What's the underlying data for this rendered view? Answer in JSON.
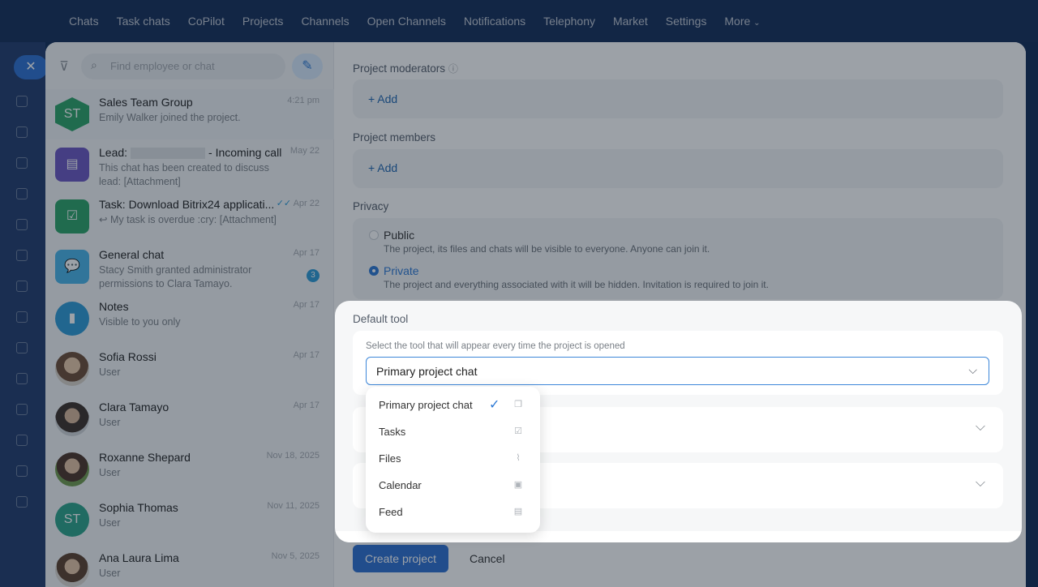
{
  "top_nav": [
    "Chats",
    "Task chats",
    "CoPilot",
    "Projects",
    "Channels",
    "Open Channels",
    "Notifications",
    "Telephony",
    "Market",
    "Settings",
    "More"
  ],
  "search": {
    "placeholder": "Find employee or chat"
  },
  "chats": [
    {
      "name": "Sales Team Group",
      "date": "4:21 pm",
      "sub": "Emily Walker joined the project.",
      "avatar_text": "ST",
      "avatar_color": "#2aa366"
    },
    {
      "name_pre": "Lead:",
      "name_post": "- Incoming call",
      "date": "May 22",
      "sub": "This chat has been created to discuss lead: [Attachment]",
      "avatar_color": "#6a55c2"
    },
    {
      "name": "Task: Download Bitrix24 applicati...",
      "date": "Apr 22",
      "sub": "My task is overdue :cry: [Attachment]",
      "avatar_color": "#2aa366"
    },
    {
      "name": "General chat",
      "date": "Apr 17",
      "sub": "Stacy Smith granted administrator permissions to Clara Tamayo.",
      "badge": "3",
      "avatar_color": "#47b4e8"
    },
    {
      "name": "Notes",
      "date": "Apr 17",
      "sub": "Visible to you only",
      "avatar_color": "#2b9ad6"
    },
    {
      "name": "Sofia Rossi",
      "date": "Apr 17",
      "sub": "User",
      "avatar_color": "#c9a27e"
    },
    {
      "name": "Clara Tamayo",
      "date": "Apr 17",
      "sub": "User",
      "avatar_color": "#6b5a4e"
    },
    {
      "name": "Roxanne Shepard",
      "date": "Nov 18, 2025",
      "sub": "User",
      "avatar_color": "#7a9b5f"
    },
    {
      "name": "Sophia Thomas",
      "date": "Nov 11, 2025",
      "sub": "User",
      "avatar_text": "ST",
      "avatar_color": "#2aa389"
    },
    {
      "name": "Ana Laura Lima",
      "date": "Nov 5, 2025",
      "sub": "User",
      "avatar_color": "#b08a6c"
    }
  ],
  "form": {
    "moderators_label": "Project moderators",
    "members_label": "Project members",
    "add_label": "+ Add",
    "privacy_label": "Privacy",
    "public_title": "Public",
    "public_desc": "The project, its files and chats will be visible to everyone. Anyone can join it.",
    "private_title": "Private",
    "private_desc": "The project and everything associated with it will be hidden. Invitation is required to join it.",
    "create_button": "Create project",
    "cancel_button": "Cancel"
  },
  "default_tool": {
    "title": "Default tool",
    "description": "Select the tool that will appear every time the project is opened",
    "selected": "Primary project chat",
    "options": [
      "Primary project chat",
      "Tasks",
      "Files",
      "Calendar",
      "Feed"
    ]
  }
}
